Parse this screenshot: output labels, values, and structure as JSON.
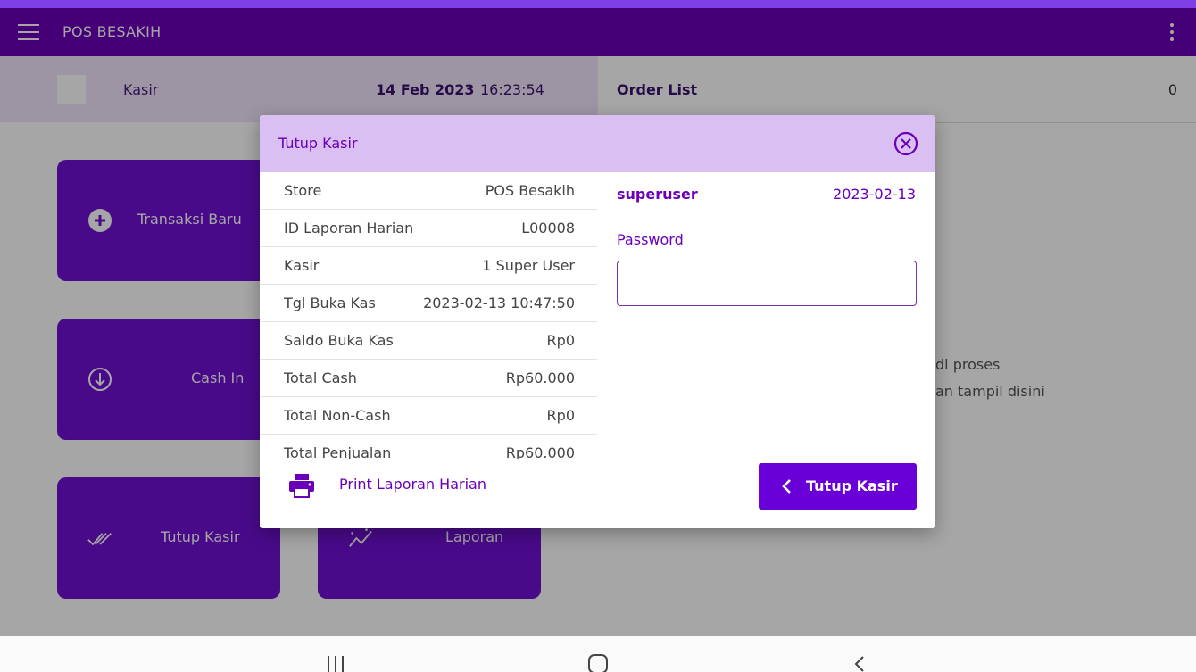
{
  "appbar": {
    "title": "POS BESAKIH"
  },
  "info": {
    "kasir": "Kasir",
    "date": "14 Feb 2023",
    "time": "16:23:54"
  },
  "tiles": {
    "new_transaction": "Transaksi Baru",
    "cash_in": "Cash In",
    "close_cashier": "Tutup Kasir",
    "report": "Laporan"
  },
  "order": {
    "title": "Order List",
    "count": "0",
    "empty_line1": "di proses",
    "empty_line2": "an tampil disini"
  },
  "dialog": {
    "title": "Tutup Kasir",
    "rows": [
      {
        "label": "Store",
        "value": "POS Besakih"
      },
      {
        "label": "ID Laporan Harian",
        "value": "L00008"
      },
      {
        "label": "Kasir",
        "value": "1 Super User"
      },
      {
        "label": "Tgl Buka Kas",
        "value": "2023-02-13 10:47:50"
      },
      {
        "label": "Saldo Buka Kas",
        "value": "Rp0"
      },
      {
        "label": "Total Cash",
        "value": "Rp60.000"
      },
      {
        "label": "Total Non-Cash",
        "value": "Rp0"
      },
      {
        "label": "Total Penjualan",
        "value": "Rp60.000"
      }
    ],
    "print_label": "Print Laporan Harian",
    "username": "superuser",
    "login_date": "2023-02-13",
    "password_label": "Password",
    "password_value": "",
    "close_button": "Tutup Kasir"
  },
  "colors": {
    "primary": "#6a00b8",
    "accent": "#7010d4",
    "header_tint": "#d9bff2"
  }
}
